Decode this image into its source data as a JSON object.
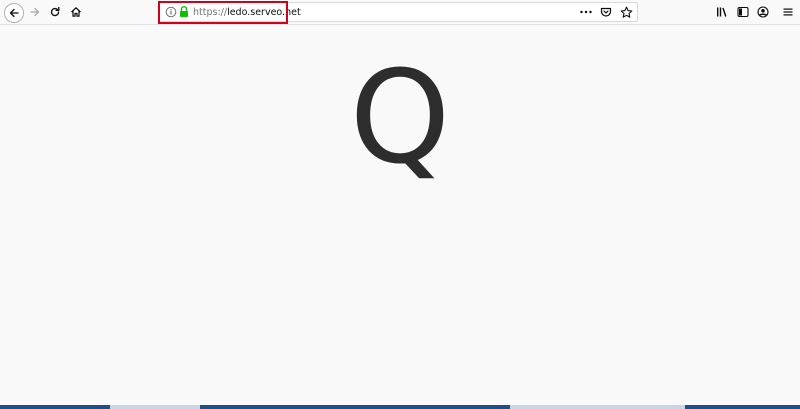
{
  "browser": {
    "url_scheme": "https://",
    "url_host": "ledo.serveo.net",
    "icons": {
      "back": "back-arrow-icon",
      "forward": "forward-arrow-icon",
      "reload": "reload-icon",
      "home": "home-icon",
      "info": "info-icon",
      "lock": "lock-icon",
      "page_actions": "more-dots-icon",
      "pocket": "pocket-icon",
      "bookmark": "star-icon",
      "library": "library-icon",
      "sidebar": "sidebar-icon",
      "account": "account-icon",
      "menu": "hamburger-menu-icon"
    },
    "colors": {
      "lock": "#12bc00",
      "highlight": "#d0021b"
    }
  },
  "page": {
    "glyph": "Q"
  }
}
